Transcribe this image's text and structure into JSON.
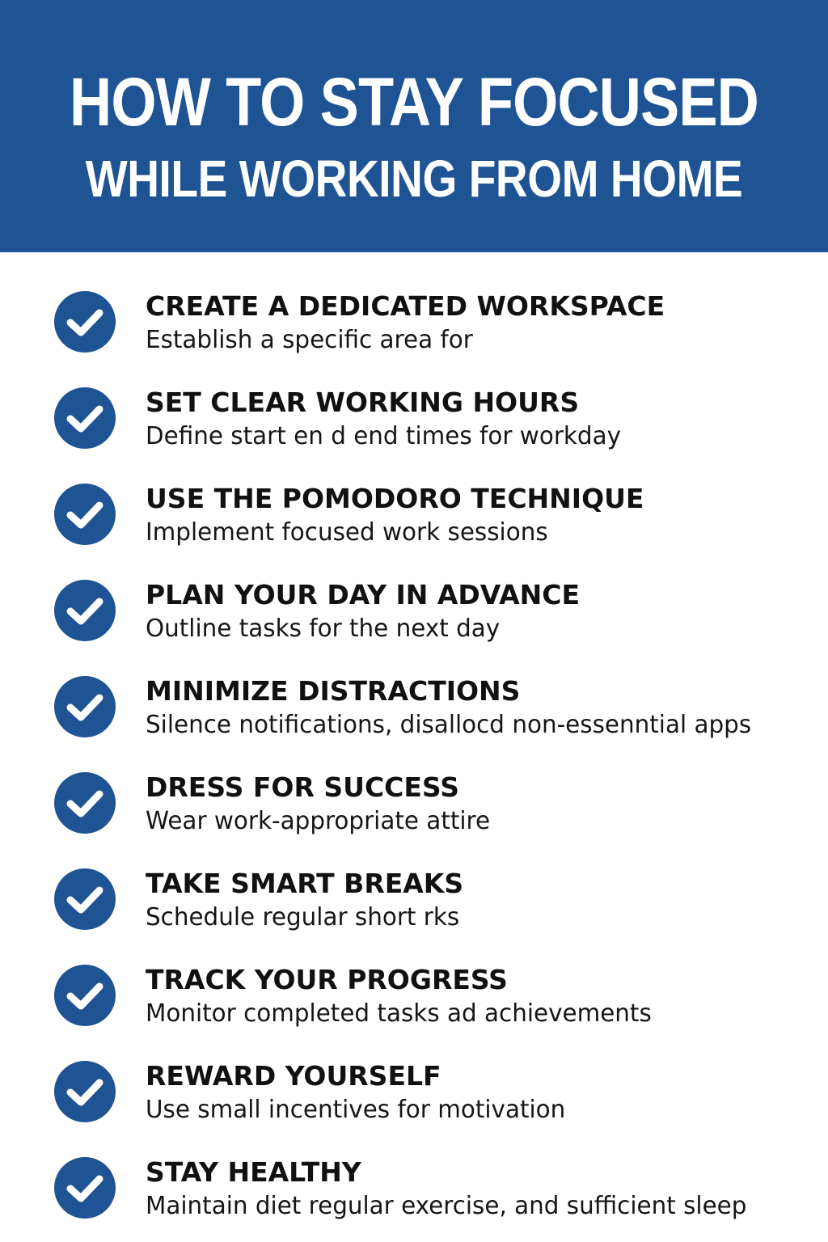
{
  "header": {
    "title_line1": "HOW TO STAY FOCUSED",
    "title_line2": "WHILE WORKING FROM HOME"
  },
  "colors": {
    "brand_blue": "#1e5394",
    "check_mark": "#ffffff",
    "text": "#111111"
  },
  "tips": [
    {
      "icon": "check-circle-icon",
      "title": "CREATE A DEDICATED WORKSPACE",
      "description": "Establish a specific area for"
    },
    {
      "icon": "check-circle-icon",
      "title": "SET CLEAR WORKING HOURS",
      "description": "Define start en d end times for workday"
    },
    {
      "icon": "check-circle-icon",
      "title": "USE THE POMODORO TECHNIQUE",
      "description": "Implement focused work sessions"
    },
    {
      "icon": "check-circle-icon",
      "title": "PLAN YOUR DAY IN ADVANCE",
      "description": "Outline tasks for the next day"
    },
    {
      "icon": "check-circle-icon",
      "title": "MINIMIZE DISTRACTIONS",
      "description": "Silence notifications, disallocd non-essenntial apps"
    },
    {
      "icon": "check-circle-icon",
      "title": "DRESS FOR SUCCESS",
      "description": "Wear work-appropriate attire"
    },
    {
      "icon": "check-circle-icon",
      "title": "TAKE SMART BREAKS",
      "description": "Schedule regular short rks"
    },
    {
      "icon": "check-circle-icon",
      "title": "TRACK YOUR PROGRESS",
      "description": "Monitor completed tasks ad achievements"
    },
    {
      "icon": "check-circle-icon",
      "title": "REWARD YOURSELF",
      "description": "Use small incentives for motivation"
    },
    {
      "icon": "check-circle-icon",
      "title": "STAY HEALTHY",
      "description": "Maintain diet regular exercise, and sufficient sleep"
    }
  ]
}
